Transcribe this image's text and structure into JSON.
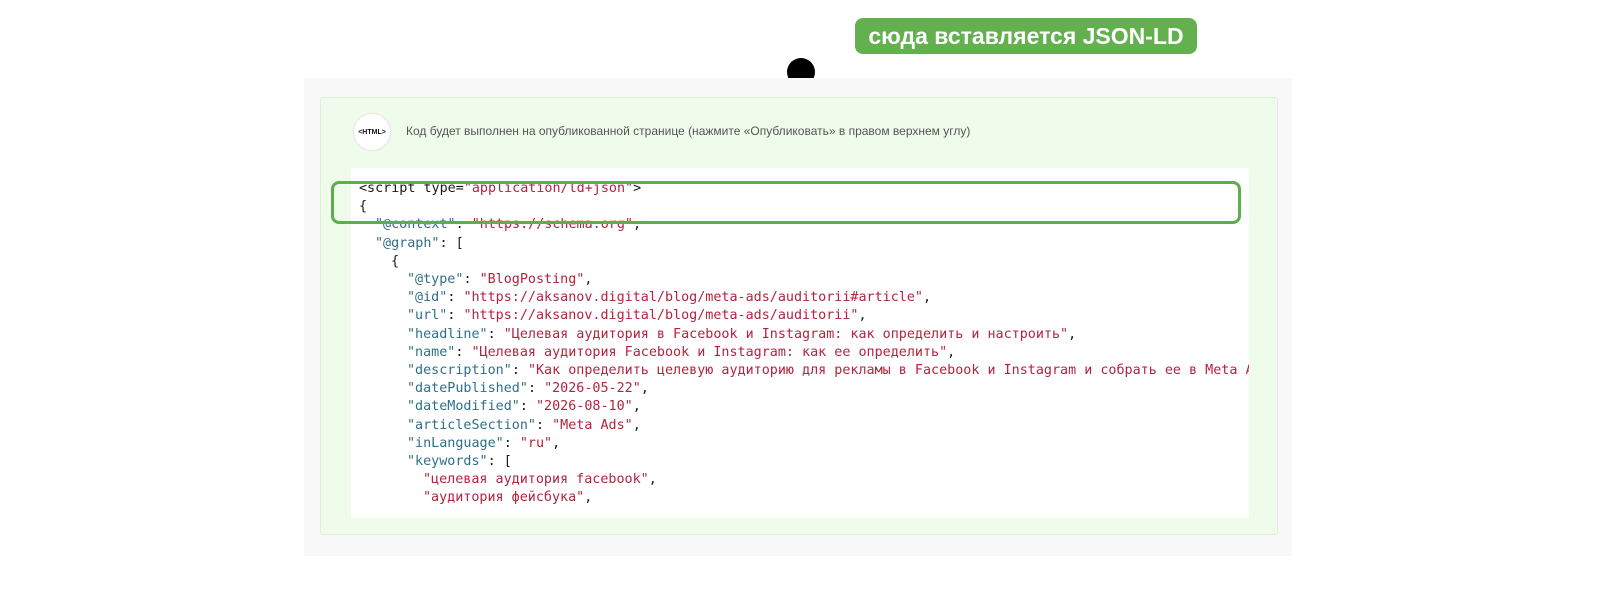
{
  "callout": {
    "text": "сюда вставляется JSON-LD"
  },
  "html_block": {
    "badge_text": "<HTML>",
    "notice": "Код будет выполнен на опубликованной странице (нажмите «Опубликовать» в правом верхнем углу)"
  },
  "code": {
    "lines": [
      {
        "indent": 0,
        "parts": [
          {
            "t": "<script type=",
            "c": "p"
          },
          {
            "t": "\"application/ld+json\"",
            "c": "s"
          },
          {
            "t": ">",
            "c": "p"
          }
        ]
      },
      {
        "indent": 0,
        "parts": [
          {
            "t": "{",
            "c": "p"
          }
        ]
      },
      {
        "indent": 1,
        "parts": [
          {
            "t": "\"@context\"",
            "c": "k"
          },
          {
            "t": ": ",
            "c": "p"
          },
          {
            "t": "\"https://schema.org\"",
            "c": "s"
          },
          {
            "t": ",",
            "c": "p"
          }
        ]
      },
      {
        "indent": 1,
        "parts": [
          {
            "t": "\"@graph\"",
            "c": "k"
          },
          {
            "t": ": [",
            "c": "p"
          }
        ]
      },
      {
        "indent": 2,
        "parts": [
          {
            "t": "{",
            "c": "p"
          }
        ]
      },
      {
        "indent": 3,
        "parts": [
          {
            "t": "\"@type\"",
            "c": "k"
          },
          {
            "t": ": ",
            "c": "p"
          },
          {
            "t": "\"BlogPosting\"",
            "c": "s"
          },
          {
            "t": ",",
            "c": "p"
          }
        ]
      },
      {
        "indent": 3,
        "parts": [
          {
            "t": "\"@id\"",
            "c": "k"
          },
          {
            "t": ": ",
            "c": "p"
          },
          {
            "t": "\"https://aksanov.digital/blog/meta-ads/auditorii#article\"",
            "c": "s"
          },
          {
            "t": ",",
            "c": "p"
          }
        ]
      },
      {
        "indent": 3,
        "parts": [
          {
            "t": "\"url\"",
            "c": "k"
          },
          {
            "t": ": ",
            "c": "p"
          },
          {
            "t": "\"https://aksanov.digital/blog/meta-ads/auditorii\"",
            "c": "s"
          },
          {
            "t": ",",
            "c": "p"
          }
        ]
      },
      {
        "indent": 3,
        "parts": [
          {
            "t": "\"headline\"",
            "c": "k"
          },
          {
            "t": ": ",
            "c": "p"
          },
          {
            "t": "\"Целевая аудитория в Facebook и Instagram: как определить и настроить\"",
            "c": "s"
          },
          {
            "t": ",",
            "c": "p"
          }
        ]
      },
      {
        "indent": 3,
        "parts": [
          {
            "t": "\"name\"",
            "c": "k"
          },
          {
            "t": ": ",
            "c": "p"
          },
          {
            "t": "\"Целевая аудитория Facebook и Instagram: как ее определить\"",
            "c": "s"
          },
          {
            "t": ",",
            "c": "p"
          }
        ]
      },
      {
        "indent": 3,
        "parts": [
          {
            "t": "\"description\"",
            "c": "k"
          },
          {
            "t": ": ",
            "c": "p"
          },
          {
            "t": "\"Как определить целевую аудиторию для рекламы в Facebook и Instagram и собрать ее в Meta Ads",
            "c": "s"
          }
        ]
      },
      {
        "indent": 3,
        "parts": [
          {
            "t": "\"datePublished\"",
            "c": "k"
          },
          {
            "t": ": ",
            "c": "p"
          },
          {
            "t": "\"2026-05-22\"",
            "c": "s"
          },
          {
            "t": ",",
            "c": "p"
          }
        ]
      },
      {
        "indent": 3,
        "parts": [
          {
            "t": "\"dateModified\"",
            "c": "k"
          },
          {
            "t": ": ",
            "c": "p"
          },
          {
            "t": "\"2026-08-10\"",
            "c": "s"
          },
          {
            "t": ",",
            "c": "p"
          }
        ]
      },
      {
        "indent": 3,
        "parts": [
          {
            "t": "\"articleSection\"",
            "c": "k"
          },
          {
            "t": ": ",
            "c": "p"
          },
          {
            "t": "\"Meta Ads\"",
            "c": "s"
          },
          {
            "t": ",",
            "c": "p"
          }
        ]
      },
      {
        "indent": 3,
        "parts": [
          {
            "t": "\"inLanguage\"",
            "c": "k"
          },
          {
            "t": ": ",
            "c": "p"
          },
          {
            "t": "\"ru\"",
            "c": "s"
          },
          {
            "t": ",",
            "c": "p"
          }
        ]
      },
      {
        "indent": 3,
        "parts": [
          {
            "t": "\"keywords\"",
            "c": "k"
          },
          {
            "t": ": [",
            "c": "p"
          }
        ]
      },
      {
        "indent": 4,
        "parts": [
          {
            "t": "\"целевая аудитория facebook\"",
            "c": "s"
          },
          {
            "t": ",",
            "c": "p"
          }
        ]
      },
      {
        "indent": 4,
        "parts": [
          {
            "t": "\"аудитория фейсбука\"",
            "c": "s"
          },
          {
            "t": ",",
            "c": "p"
          }
        ]
      }
    ]
  }
}
